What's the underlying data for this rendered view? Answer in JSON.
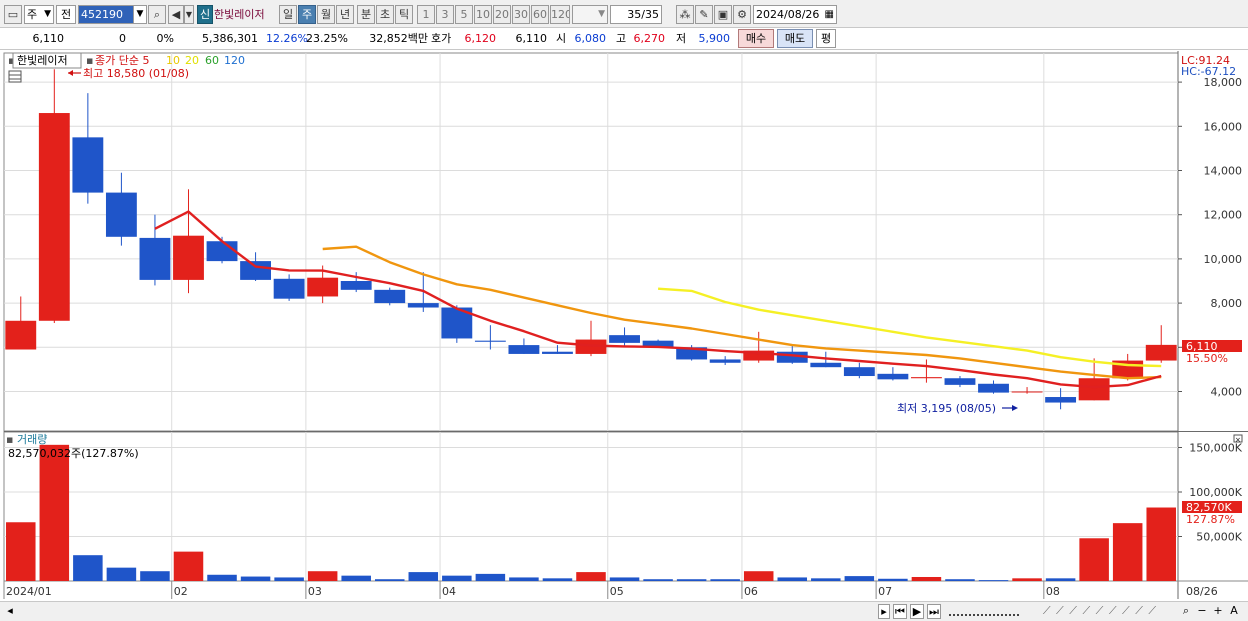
{
  "toolbar": {
    "period_select": "주",
    "prev_label": "전",
    "code": "452190",
    "shin_badge": "신",
    "stock_name": "한빛레이저",
    "timeframes": [
      "일",
      "주",
      "월",
      "년",
      "분",
      "초",
      "틱"
    ],
    "active_timeframe": "주",
    "multipliers": [
      "1",
      "3",
      "5",
      "10",
      "20",
      "30",
      "60",
      "120"
    ],
    "count": "35/35",
    "date": "2024/08/26"
  },
  "quote": {
    "price": "6,110",
    "change": "0",
    "change_pct": "0%",
    "volume": "5,386,301",
    "turnover_pct": "12.26%",
    "pct2": "23.25%",
    "amount": "32,852백만",
    "hoga_label": "호가",
    "ask": "6,120",
    "bid": "6,110",
    "open_label": "시",
    "open": "6,080",
    "high_label": "고",
    "high": "6,270",
    "low_label": "저",
    "low": "5,900",
    "buy_label": "매수",
    "sell_label": "매도",
    "flat_label": "평"
  },
  "legend": {
    "name": "한빛레이저",
    "series_label": "종가 단순 5",
    "ma": [
      {
        "label": "10",
        "color": "#e8c800"
      },
      {
        "label": "20",
        "color": "#e0e000"
      },
      {
        "label": "60",
        "color": "#2aa02a"
      },
      {
        "label": "120",
        "color": "#1e6fd0"
      }
    ],
    "lc": "LC:91.24",
    "hc": "HC:-67.12"
  },
  "colors": {
    "up": "#e3211b",
    "down": "#1f55c9",
    "ma5": "#e02020",
    "ma10": "#f0960f",
    "ma20": "#f5f025"
  },
  "chart_data": {
    "type": "candlestick",
    "y_ticks": [
      "18,000",
      "16,000",
      "14,000",
      "12,000",
      "10,000",
      "8,000",
      "6,000",
      "4,000"
    ],
    "ylim": [
      3000,
      19000
    ],
    "candles": [
      {
        "o": 5900,
        "h": 8300,
        "l": 5900,
        "c": 7200
      },
      {
        "o": 7200,
        "h": 18580,
        "l": 7100,
        "c": 16600
      },
      {
        "o": 15500,
        "h": 17500,
        "l": 12500,
        "c": 13000
      },
      {
        "o": 13000,
        "h": 13900,
        "l": 10600,
        "c": 11000
      },
      {
        "o": 10950,
        "h": 12000,
        "l": 8800,
        "c": 9050
      },
      {
        "o": 9050,
        "h": 13150,
        "l": 8450,
        "c": 11050
      },
      {
        "o": 10800,
        "h": 11000,
        "l": 9800,
        "c": 9900
      },
      {
        "o": 9900,
        "h": 10300,
        "l": 9000,
        "c": 9050
      },
      {
        "o": 9100,
        "h": 9300,
        "l": 8100,
        "c": 8200
      },
      {
        "o": 8300,
        "h": 9700,
        "l": 8000,
        "c": 9150
      },
      {
        "o": 9000,
        "h": 9400,
        "l": 8500,
        "c": 8600
      },
      {
        "o": 8600,
        "h": 8700,
        "l": 7900,
        "c": 8000
      },
      {
        "o": 8000,
        "h": 9400,
        "l": 7600,
        "c": 7800
      },
      {
        "o": 7800,
        "h": 7900,
        "l": 6200,
        "c": 6400
      },
      {
        "o": 6300,
        "h": 7000,
        "l": 5900,
        "c": 6250
      },
      {
        "o": 6100,
        "h": 6400,
        "l": 5700,
        "c": 5700
      },
      {
        "o": 5800,
        "h": 6100,
        "l": 5700,
        "c": 5700
      },
      {
        "o": 5700,
        "h": 7200,
        "l": 5600,
        "c": 6350
      },
      {
        "o": 6550,
        "h": 6900,
        "l": 6000,
        "c": 6200
      },
      {
        "o": 6300,
        "h": 6350,
        "l": 6000,
        "c": 6000
      },
      {
        "o": 6000,
        "h": 6100,
        "l": 5400,
        "c": 5450
      },
      {
        "o": 5450,
        "h": 5600,
        "l": 5200,
        "c": 5300
      },
      {
        "o": 5400,
        "h": 6700,
        "l": 5300,
        "c": 5850
      },
      {
        "o": 5800,
        "h": 6100,
        "l": 5250,
        "c": 5300
      },
      {
        "o": 5300,
        "h": 5800,
        "l": 5100,
        "c": 5100
      },
      {
        "o": 5100,
        "h": 5300,
        "l": 4600,
        "c": 4700
      },
      {
        "o": 4800,
        "h": 5100,
        "l": 4500,
        "c": 4550
      },
      {
        "o": 4600,
        "h": 5450,
        "l": 4400,
        "c": 4650
      },
      {
        "o": 4600,
        "h": 4700,
        "l": 4200,
        "c": 4300
      },
      {
        "o": 4350,
        "h": 4500,
        "l": 3900,
        "c": 3950
      },
      {
        "o": 4000,
        "h": 4200,
        "l": 3900,
        "c": 4000
      },
      {
        "o": 3750,
        "h": 4150,
        "l": 3195,
        "c": 3500
      },
      {
        "o": 3600,
        "h": 5500,
        "l": 3600,
        "c": 4600
      },
      {
        "o": 4600,
        "h": 5700,
        "l": 4500,
        "c": 5400
      },
      {
        "o": 5400,
        "h": 7000,
        "l": 5300,
        "c": 6110
      }
    ],
    "ma5": [
      null,
      null,
      null,
      null,
      11360,
      12140,
      10800,
      9650,
      9480,
      9470,
      9180,
      8900,
      8550,
      7750,
      7200,
      6730,
      6210,
      6080,
      6040,
      6020,
      5940,
      5830,
      5740,
      5640,
      5500,
      5380,
      5260,
      5150,
      4970,
      4770,
      4600,
      4320,
      4200,
      4290,
      4700
    ],
    "ma10": [
      null,
      null,
      null,
      null,
      null,
      null,
      null,
      null,
      null,
      10450,
      10550,
      9850,
      9300,
      8850,
      8600,
      8250,
      7900,
      7550,
      7250,
      7050,
      6850,
      6600,
      6350,
      6100,
      5950,
      5850,
      5750,
      5650,
      5500,
      5300,
      5100,
      4900,
      4750,
      4600,
      4650
    ],
    "ma20": [
      null,
      null,
      null,
      null,
      null,
      null,
      null,
      null,
      null,
      null,
      null,
      null,
      null,
      null,
      null,
      null,
      null,
      null,
      null,
      8650,
      8550,
      8050,
      7700,
      7450,
      7200,
      6950,
      6700,
      6450,
      6250,
      6050,
      5850,
      5550,
      5350,
      5200,
      5150
    ],
    "price_badge": "6,110",
    "pct_badge": "15.50%",
    "annotation_high": "최고 18,580 (01/08)",
    "annotation_low": "최저 3,195 (08/05)",
    "volume_label": "거래량",
    "volume_readout": "82,570,032주(127.87%)",
    "volume_ticks": [
      "150,000K",
      "100,000K",
      "50,000K"
    ],
    "volume_ylim": [
      0,
      160000
    ],
    "volume_badge": "82,570K",
    "volume_pct_badge": "127.87%",
    "volumes": [
      66000,
      153000,
      29000,
      15000,
      11000,
      33000,
      7000,
      5000,
      4000,
      11000,
      6000,
      2000,
      10000,
      6000,
      8000,
      4000,
      3000,
      10000,
      4000,
      2000,
      2000,
      2000,
      11000,
      4000,
      3000,
      5500,
      2500,
      4500,
      2000,
      1000,
      3000,
      3000,
      48000,
      65000,
      82570
    ],
    "x_labels": [
      "2024/01",
      "02",
      "03",
      "04",
      "05",
      "06",
      "07",
      "08",
      "08/26"
    ]
  },
  "bottom": {
    "zoom_icons": [
      "+",
      "−",
      "A"
    ]
  }
}
